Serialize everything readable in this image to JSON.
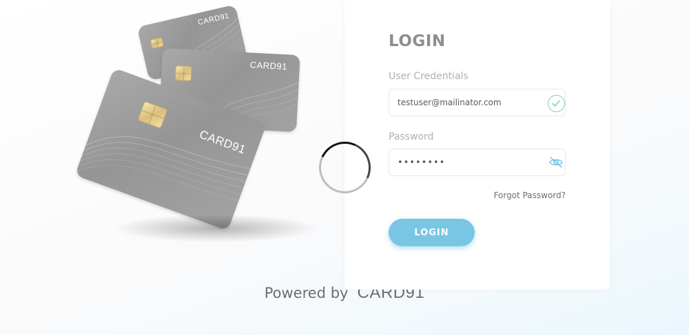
{
  "illustration": {
    "card_brand": "CARD91"
  },
  "login": {
    "title": "LOGIN",
    "user_label": "User Credentials",
    "user_value": "testuser@mailinator.com",
    "password_label": "Password",
    "password_value": "••••••••",
    "forgot_label": "Forgot Password?",
    "button_label": "LOGIN"
  },
  "footer": {
    "powered_by": "Powered by",
    "brand": "CARD91"
  },
  "colors": {
    "accent": "#79c5e4",
    "success": "#7fd3a8",
    "card_gray": "#9e9e9e"
  },
  "icons": {
    "user_status": "check-circle-icon",
    "password_toggle": "eye-off-icon"
  }
}
